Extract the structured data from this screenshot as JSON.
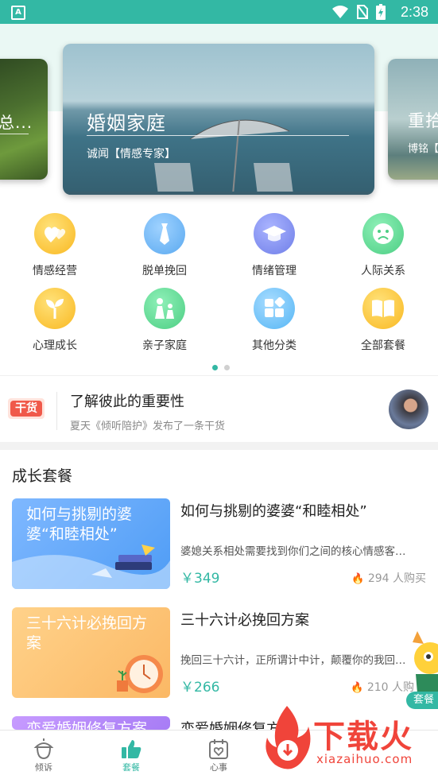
{
  "status_bar": {
    "time": "2:38",
    "app_icon_letter": "A"
  },
  "banners": [
    {
      "title": "婚姻家庭",
      "subtitle": "诚闻【情感专家】"
    },
    {
      "title": "重拾",
      "subtitle": "博铭【"
    },
    {
      "title": "总..."
    }
  ],
  "categories": [
    {
      "label": "情感经营",
      "icon": "hearts-icon",
      "color": "#f9c22e"
    },
    {
      "label": "脱单挽回",
      "icon": "tie-icon",
      "color": "#5aa9f0"
    },
    {
      "label": "情绪管理",
      "icon": "graduation-cap-icon",
      "color": "#6f7ee8"
    },
    {
      "label": "人际关系",
      "icon": "sad-face-icon",
      "color": "#4cce83"
    },
    {
      "label": "心理成长",
      "icon": "sprout-icon",
      "color": "#f9b821"
    },
    {
      "label": "亲子家庭",
      "icon": "family-icon",
      "color": "#4cce83"
    },
    {
      "label": "其他分类",
      "icon": "blocks-icon",
      "color": "#55b6f5"
    },
    {
      "label": "全部套餐",
      "icon": "book-icon",
      "color": "#f9b821"
    }
  ],
  "pager": {
    "total": 2,
    "active": 0
  },
  "news": {
    "tag": "干货",
    "title": "了解彼此的重要性",
    "desc": "夏天《倾听陪护》发布了一条干货"
  },
  "section_title": "成长套餐",
  "packages": [
    {
      "cover_text": "如何与挑剔的婆婆“和睦相处”",
      "title": "如何与挑剔的婆婆“和睦相处”",
      "desc": "婆媳关系相处需要找到你们之间的核心情感客…",
      "price": "￥349",
      "sold_count": "294",
      "sold_suffix": "人购买"
    },
    {
      "cover_text": "三十六计必挽回方案",
      "title": "三十六计必挽回方案",
      "desc": "挽回三十六计，正所谓计中计，颠覆你的我回…",
      "price": "￥266",
      "sold_count": "210",
      "sold_suffix": "人购"
    },
    {
      "cover_text": "恋爱婚姻修复方案",
      "title": "恋爱婚姻修复方案"
    }
  ],
  "float_badge": "套餐",
  "tabs": [
    {
      "label": "倾诉",
      "icon": "acorn-icon"
    },
    {
      "label": "套餐",
      "icon": "thumbs-up-icon"
    },
    {
      "label": "心事",
      "icon": "calendar-heart-icon"
    }
  ],
  "watermark": {
    "big": "下载火",
    "small": "xiazaihuo.com"
  },
  "colors": {
    "accent": "#33b8a4",
    "price": "#33b8a4",
    "flame": "#ff6a55",
    "tag": "#f0594a"
  }
}
